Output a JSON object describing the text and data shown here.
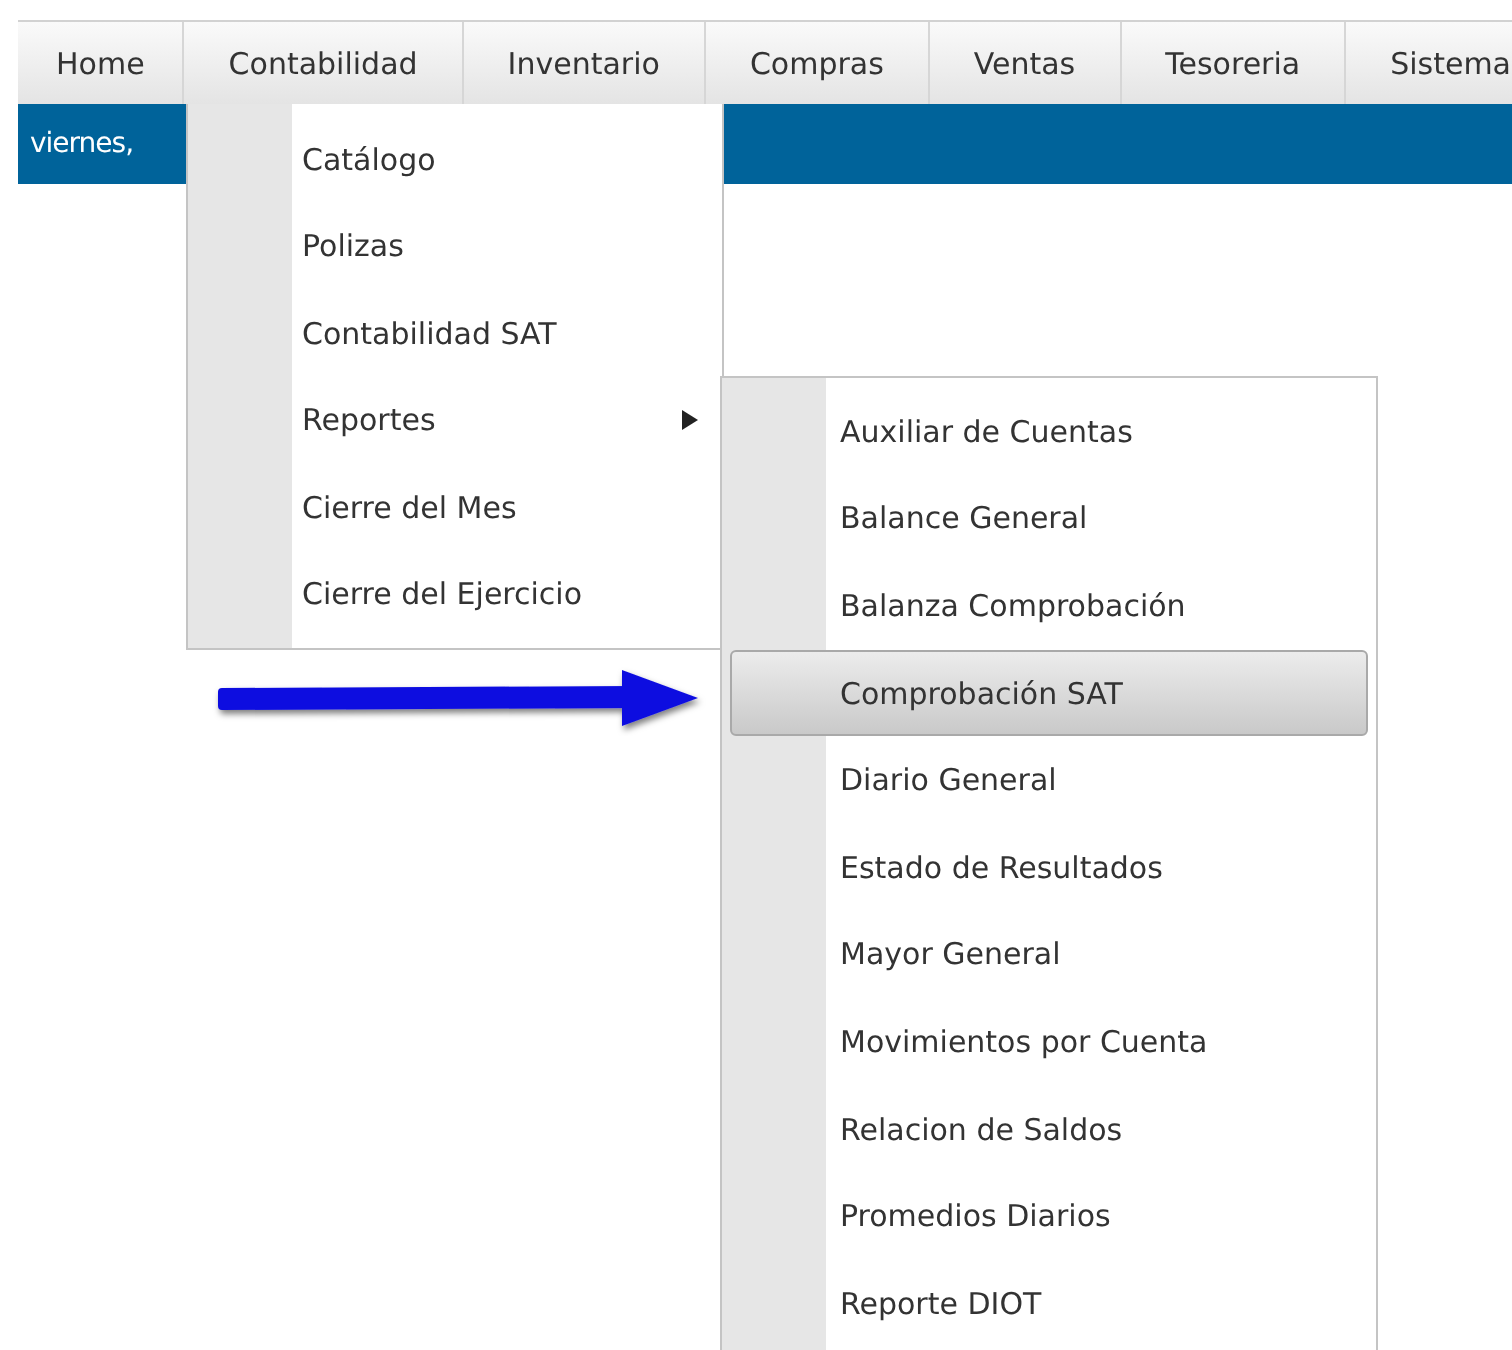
{
  "menubar": {
    "items": [
      {
        "label": "Home"
      },
      {
        "label": "Contabilidad"
      },
      {
        "label": "Inventario"
      },
      {
        "label": "Compras"
      },
      {
        "label": "Ventas"
      },
      {
        "label": "Tesoreria"
      },
      {
        "label": "Sistema"
      }
    ]
  },
  "date_bar": {
    "text": "viernes,"
  },
  "dropdown": {
    "items": [
      {
        "label": "Catálogo",
        "has_submenu": false
      },
      {
        "label": "Polizas",
        "has_submenu": false
      },
      {
        "label": "Contabilidad SAT",
        "has_submenu": false
      },
      {
        "label": "Reportes",
        "has_submenu": true
      },
      {
        "label": "Cierre del Mes",
        "has_submenu": false
      },
      {
        "label": "Cierre del Ejercicio",
        "has_submenu": false
      }
    ]
  },
  "submenu": {
    "items": [
      {
        "label": "Auxiliar de Cuentas",
        "selected": false
      },
      {
        "label": "Balance General",
        "selected": false
      },
      {
        "label": "Balanza Comprobación",
        "selected": false
      },
      {
        "label": "Comprobación SAT",
        "selected": true
      },
      {
        "label": "Diario General",
        "selected": false
      },
      {
        "label": "Estado de Resultados",
        "selected": false
      },
      {
        "label": "Mayor General",
        "selected": false
      },
      {
        "label": "Movimientos por Cuenta",
        "selected": false
      },
      {
        "label": "Relacion de Saldos",
        "selected": false
      },
      {
        "label": "Promedios Diarios",
        "selected": false
      },
      {
        "label": "Reporte DIOT",
        "selected": false
      }
    ]
  }
}
